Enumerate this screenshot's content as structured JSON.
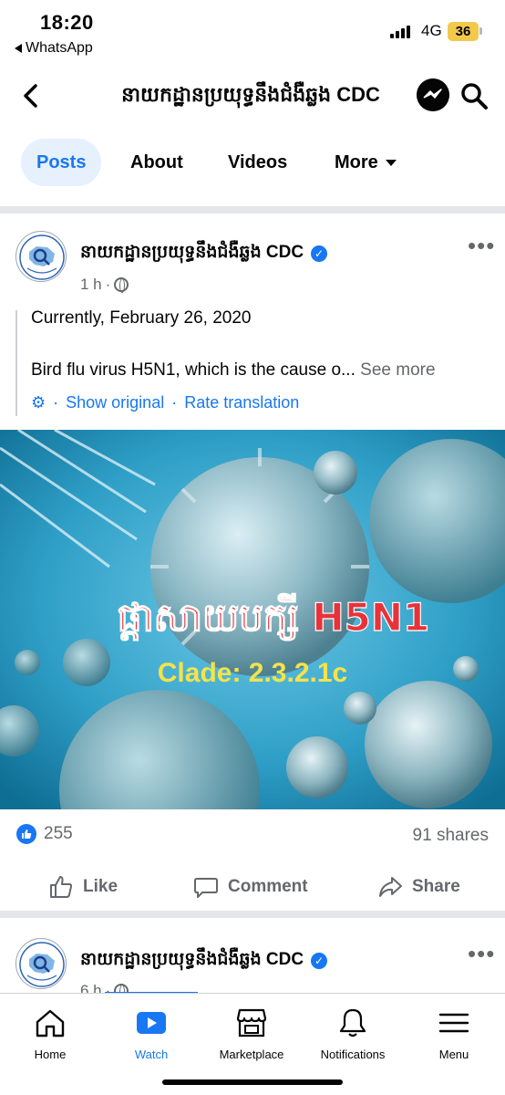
{
  "status_bar": {
    "time": "18:20",
    "back_app": "WhatsApp",
    "network": "4G",
    "battery": "36"
  },
  "header": {
    "title": "នាយកដ្ឋានប្រយុទ្ធនឹងជំងឺឆ្លង CDC",
    "back_icon": "chevron-left-icon",
    "messenger_icon": "messenger-icon",
    "search_icon": "search-icon"
  },
  "tabs": {
    "posts": "Posts",
    "about": "About",
    "videos": "Videos",
    "more": "More"
  },
  "post1": {
    "page_name": "នាយកដ្ឋានប្រយុទ្ធនឹងជំងឺឆ្លង CDC",
    "time": "1 h",
    "line1": "Currently, February 26, 2020",
    "line2": "Bird flu virus H5N1, which is the cause o...",
    "see_more": "See more",
    "show_original": "Show original",
    "rate_translation": "Rate translation",
    "image_title": "ផ្តាសាយបក្សី H5N1",
    "image_subtitle": "Clade: 2.3.2.1c",
    "likes": "255",
    "shares": "91 shares",
    "like_label": "Like",
    "comment_label": "Comment",
    "share_label": "Share"
  },
  "post2": {
    "page_name": "នាយកដ្ឋានប្រយុទ្ធនឹងជំងឺឆ្លង CDC",
    "time": "6 h"
  },
  "bottom_nav": {
    "home": "Home",
    "watch": "Watch",
    "marketplace": "Marketplace",
    "notifications": "Notifications",
    "menu": "Menu"
  },
  "colors": {
    "accent": "#1877f2",
    "secondary_text": "#65676b",
    "divider": "#e4e6eb",
    "battery": "#f2c94c"
  }
}
